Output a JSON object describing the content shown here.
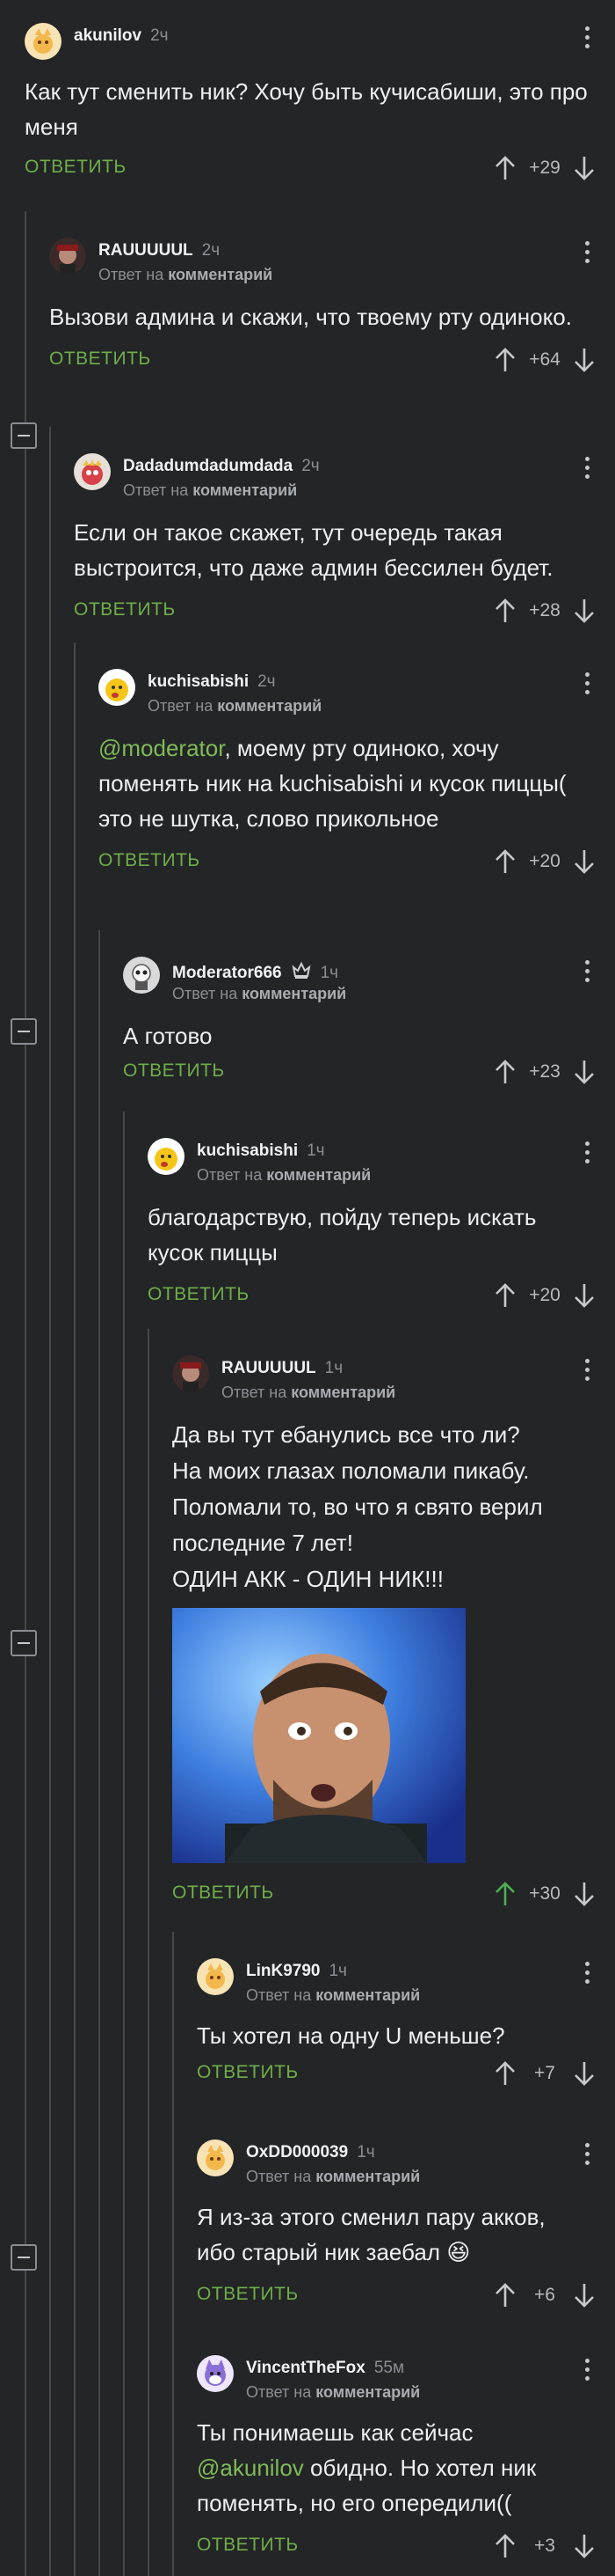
{
  "reply_label": "ОТВЕТИТЬ",
  "colors": {
    "background": "#232527",
    "link": "#7fbb57",
    "reply": "#6fae48",
    "upvoted": "#4caf50"
  },
  "comments": [
    {
      "username": "akunilov",
      "time": "2ч",
      "subline": "",
      "text": [
        "Как тут сменить ник? Хочу быть кучисабиши, это про меня"
      ],
      "score": "+29"
    },
    {
      "username": "RAUUUUUL",
      "time": "2ч",
      "subline_prefix": "Ответ на",
      "subline_bold": "комментарий",
      "text": [
        "Вызови админа и скажи, что твоему рту одиноко."
      ],
      "score": "+64"
    },
    {
      "username": "Dadadumdadumdada",
      "time": "2ч",
      "subline_prefix": "Ответ на",
      "subline_bold": "комментарий",
      "text": [
        "Если он такое скажет, тут очередь такая выстроится, что даже админ бессилен будет."
      ],
      "score": "+28"
    },
    {
      "username": "kuchisabishi",
      "time": "2ч",
      "subline_prefix": "Ответ на",
      "subline_bold": "комментарий",
      "mention": "@moderator",
      "text": [
        ", моему рту одиноко, хочу поменять ник на kuchisabishi и кусок пиццы(",
        "это не шутка, слово прикольное"
      ],
      "score": "+20"
    },
    {
      "username": "Moderator666",
      "time": "1ч",
      "badge_icon": "crown-icon",
      "subline_prefix": "Ответ на",
      "subline_bold": "комментарий",
      "text": [
        "А готово"
      ],
      "score": "+23"
    },
    {
      "username": "kuchisabishi",
      "time": "1ч",
      "subline_prefix": "Ответ на",
      "subline_bold": "комментарий",
      "text": [
        "благодарствую, пойду теперь искать кусок пиццы"
      ],
      "score": "+20"
    },
    {
      "username": "RAUUUUUL",
      "time": "1ч",
      "subline_prefix": "Ответ на",
      "subline_bold": "комментарий",
      "text": [
        "Да вы тут ебанулись все что ли?",
        "На моих глазах поломали пикабу.",
        "Поломали то, во что я свято верил",
        "последние 7 лет!",
        "ОДИН АКК - ОДИН НИК!!!"
      ],
      "score": "+30",
      "upvoted": true
    },
    {
      "username": "LinK9790",
      "time": "1ч",
      "subline_prefix": "Ответ на",
      "subline_bold": "комментарий",
      "text": [
        "Ты хотел на одну U меньше?"
      ],
      "score": "+7"
    },
    {
      "username": "OxDD000039",
      "time": "1ч",
      "subline_prefix": "Ответ на",
      "subline_bold": "комментарий",
      "text": [
        "Я из-за этого сменил пару акков, ибо старый ник заебал 😆"
      ],
      "score": "+6"
    },
    {
      "username": "VincentTheFox",
      "time": "55м",
      "subline_prefix": "Ответ на",
      "subline_bold": "комментарий",
      "mention_before": "Ты понимаешь как сейчас",
      "mention": "@akunilov",
      "text": [
        " обидно. Но хотел ник поменять, но его опередили(("
      ],
      "score": "+3"
    }
  ]
}
